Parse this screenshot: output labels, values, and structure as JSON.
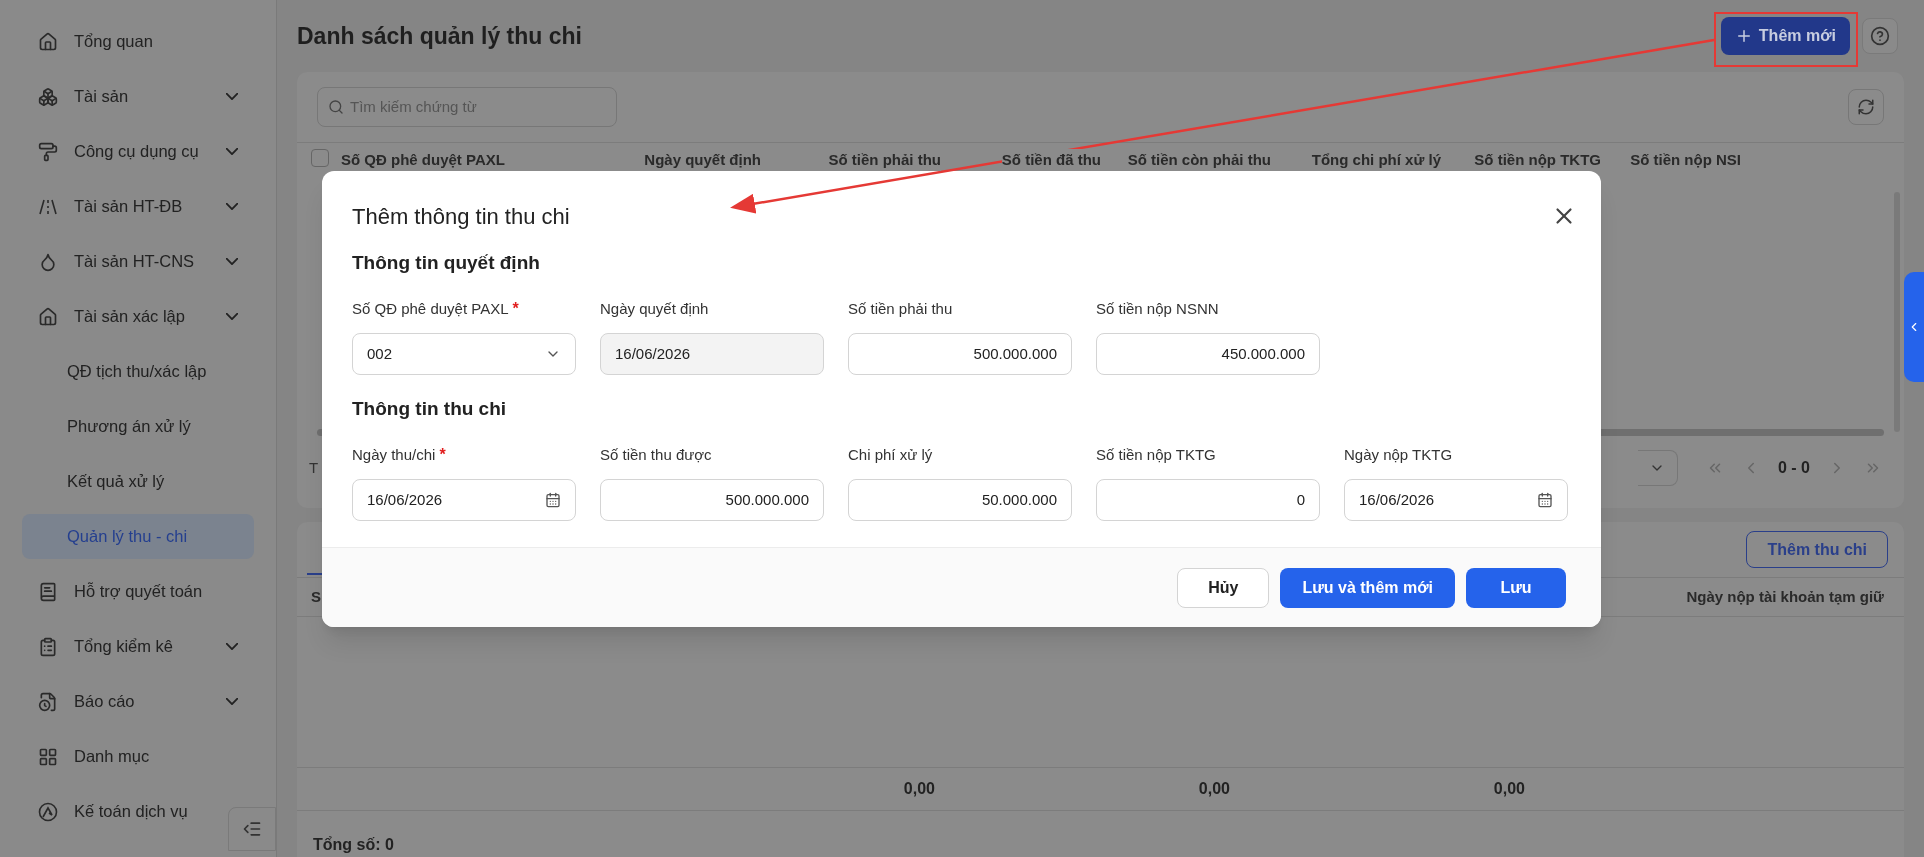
{
  "sidebar": {
    "items": [
      {
        "label": "Tổng quan",
        "selected": false,
        "expandable": false
      },
      {
        "label": "Tài sản",
        "selected": false,
        "expandable": true
      },
      {
        "label": "Công cụ dụng cụ",
        "selected": false,
        "expandable": true
      },
      {
        "label": "Tài sản HT-ĐB",
        "selected": false,
        "expandable": true
      },
      {
        "label": "Tài sản HT-CNS",
        "selected": false,
        "expandable": true
      },
      {
        "label": "Tài sản xác lập",
        "selected": false,
        "expandable": true,
        "children": [
          {
            "label": "QĐ tịch thu/xác lập",
            "selected": false
          },
          {
            "label": "Phương án xử lý",
            "selected": false
          },
          {
            "label": "Kết quả xử lý",
            "selected": false
          },
          {
            "label": "Quản lý thu - chi",
            "selected": true
          }
        ]
      },
      {
        "label": "Hỗ trợ quyết toán",
        "selected": false,
        "expandable": false
      },
      {
        "label": "Tổng kiểm kê",
        "selected": false,
        "expandable": true
      },
      {
        "label": "Báo cáo",
        "selected": false,
        "expandable": true
      },
      {
        "label": "Danh mục",
        "selected": false,
        "expandable": false
      },
      {
        "label": "Kế toán dịch vụ",
        "selected": false,
        "expandable": false
      }
    ]
  },
  "header": {
    "title": "Danh sách quản lý thu chi",
    "add_button": "Thêm mới"
  },
  "list_card": {
    "search_placeholder": "Tìm kiếm chứng từ",
    "columns": [
      "Số QĐ phê duyệt PAXL",
      "Ngày quyết định",
      "Số tiền phải thu",
      "Số tiền đã thu",
      "Số tiền còn phải thu",
      "Tổng chi phí xử lý",
      "Số tiền nộp TKTG",
      "Số tiền nộp NSI"
    ],
    "select_all_checked": false,
    "row_count_fragment": "T",
    "page_range": "0 - 0"
  },
  "detail_card": {
    "action_button": "Thêm thu chi",
    "first_column_fragment": "S",
    "last_column": "Ngày nộp tài khoản tạm giữ",
    "totals": [
      "0,00",
      "0,00",
      "0,00"
    ],
    "total_count": "Tổng số: 0"
  },
  "modal": {
    "title": "Thêm thông tin thu chi",
    "sections": [
      {
        "title": "Thông tin quyết định",
        "fields": [
          {
            "label": "Số QĐ phê duyệt PAXL",
            "required_mark": "*",
            "kind": "select",
            "value": "002"
          },
          {
            "label": "Ngày quyết định",
            "kind": "readonly",
            "value": "16/06/2026"
          },
          {
            "label": "Số tiền phải thu",
            "kind": "number",
            "value": "500.000.000"
          },
          {
            "label": "Số tiền nộp NSNN",
            "kind": "number",
            "value": "450.000.000"
          }
        ]
      },
      {
        "title": "Thông tin thu chi",
        "fields": [
          {
            "label": "Ngày thu/chi",
            "required_mark": "*",
            "kind": "date",
            "value": "16/06/2026"
          },
          {
            "label": "Số tiền thu được",
            "kind": "number",
            "value": "500.000.000"
          },
          {
            "label": "Chi phí xử lý",
            "kind": "number",
            "value": "50.000.000"
          },
          {
            "label": "Số tiền nộp TKTG",
            "kind": "number",
            "value": "0"
          },
          {
            "label": "Ngày nộp TKTG",
            "kind": "date",
            "value": "16/06/2026"
          }
        ]
      }
    ],
    "buttons": [
      {
        "label": "Hủy",
        "kind": "secondary"
      },
      {
        "label": "Lưu và thêm mới",
        "kind": "primary"
      },
      {
        "label": "Lưu",
        "kind": "primary"
      }
    ]
  }
}
